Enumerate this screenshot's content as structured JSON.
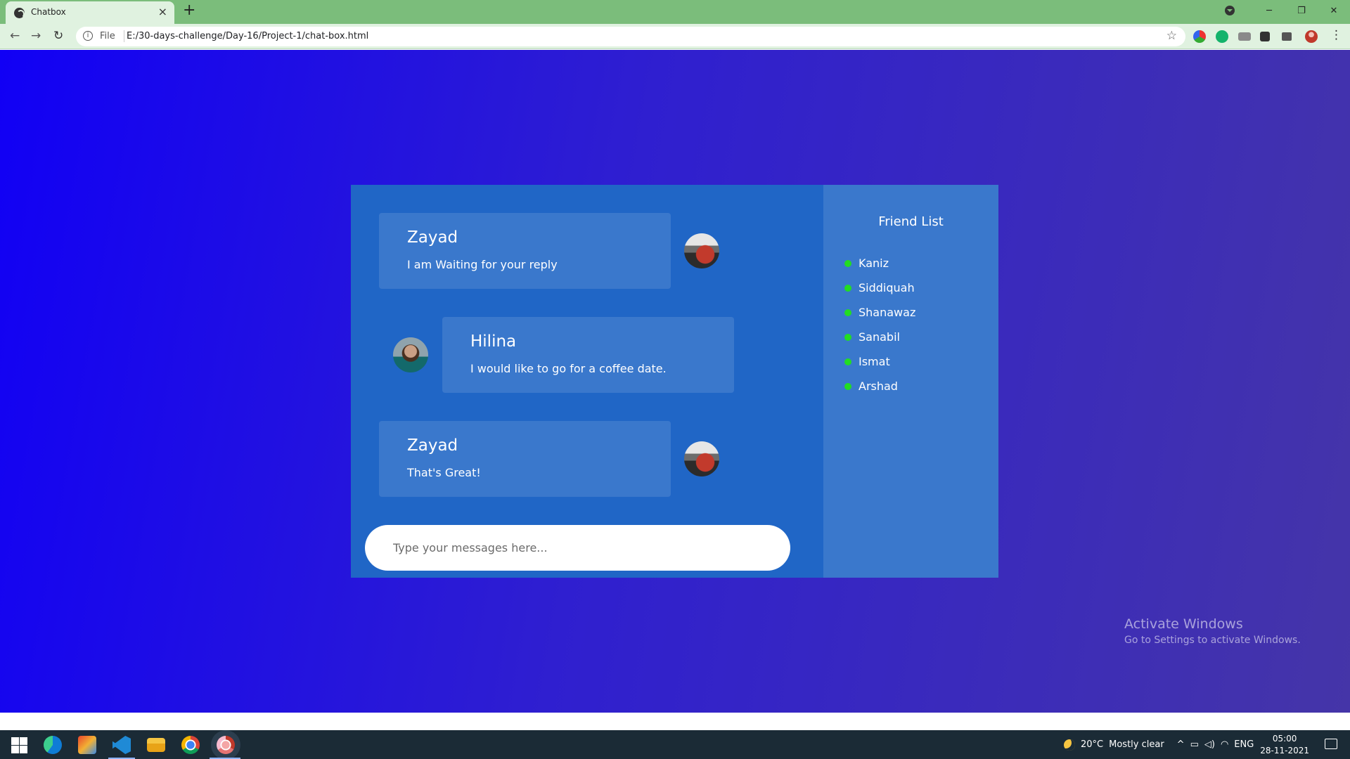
{
  "browser": {
    "tab_title": "Chatbox",
    "tab_close": "×",
    "new_tab": "+",
    "file_label": "File",
    "url": "E:/30-days-challenge/Day-16/Project-1/chat-box.html",
    "minimize": "─",
    "restore": "❐",
    "close": "✕",
    "back": "←",
    "forward": "→",
    "reload": "↻",
    "star": "☆",
    "menu": "⋮"
  },
  "chat": {
    "messages": [
      {
        "name": "Zayad",
        "text": "I am Waiting for your reply"
      },
      {
        "name": "Hilina",
        "text": "I would like to go for a coffee date."
      },
      {
        "name": "Zayad",
        "text": "That's Great!"
      }
    ],
    "input_placeholder": "Type your messages here..."
  },
  "friends": {
    "heading": "Friend List",
    "items": [
      "Kaniz",
      "Siddiquah",
      "Shanawaz",
      "Sanabil",
      "Ismat",
      "Arshad"
    ],
    "online_color": "#22dd22"
  },
  "watermark": {
    "line1": "Activate Windows",
    "line2": "Go to Settings to activate Windows."
  },
  "taskbar": {
    "weather_temp": "20°C",
    "weather_text": "Mostly clear",
    "language": "ENG",
    "time": "05:00",
    "date": "28-11-2021"
  },
  "colors": {
    "chat_bg": "#2066c6",
    "bubble_bg": "#3a78cc",
    "page_gradient_start": "#1100f5",
    "page_gradient_end": "#4535a8"
  }
}
